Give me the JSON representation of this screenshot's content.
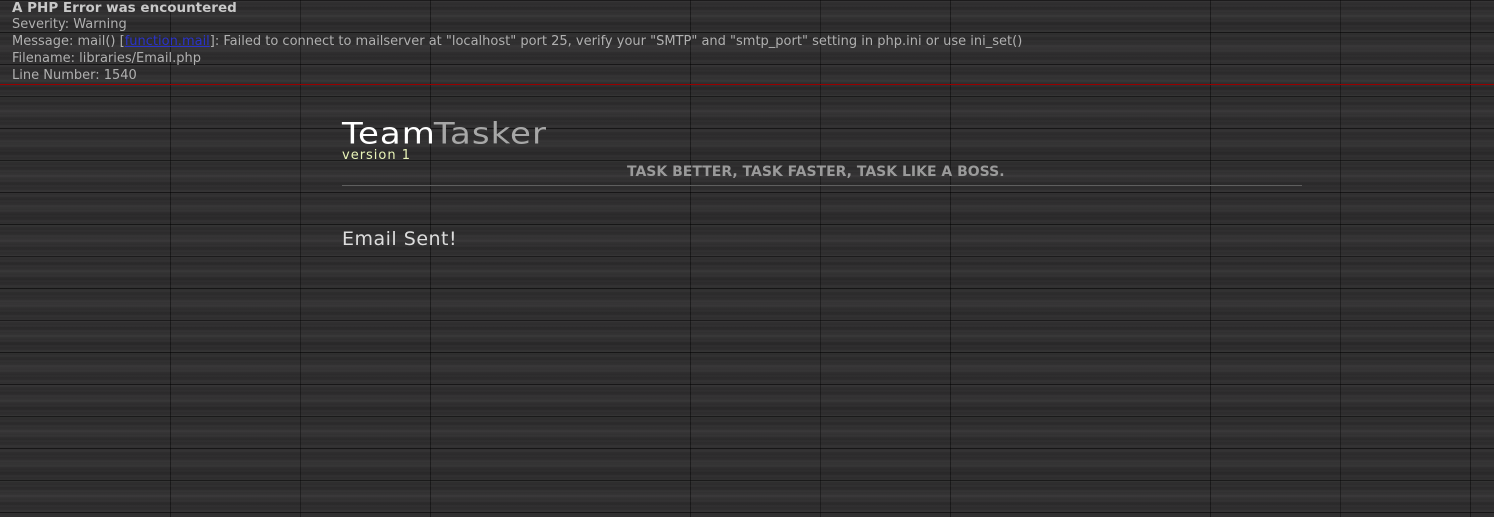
{
  "php_error": {
    "heading": "A PHP Error was encountered",
    "severity": "Severity: Warning",
    "message_prefix": "Message: mail() [",
    "message_link": "function.mail",
    "message_suffix": "]: Failed to connect to mailserver at \"localhost\" port 25, verify your \"SMTP\" and \"smtp_port\" setting in php.ini or use ini_set()",
    "filename": "Filename: libraries/Email.php",
    "line_number": "Line Number: 1540"
  },
  "header": {
    "logo_team": "Team",
    "logo_tasker": "Tasker",
    "version": "version 1",
    "tagline": "TASK BETTER, TASK FASTER, TASK LIKE A BOSS."
  },
  "main": {
    "message": "Email Sent!"
  },
  "colors": {
    "error_rule": "#990000",
    "link": "#2a33c9",
    "version_text": "#e9f5b8"
  }
}
